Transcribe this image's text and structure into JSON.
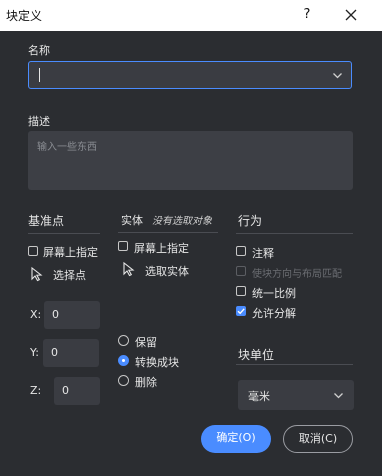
{
  "window": {
    "title": "块定义",
    "help": "?"
  },
  "name": {
    "label": "名称",
    "value": ""
  },
  "description": {
    "label": "描述",
    "placeholder": "输入一些东西"
  },
  "base_point": {
    "heading": "基准点",
    "specify_on_screen": "屏幕上指定",
    "pick_point": "选择点",
    "x": {
      "label": "X:",
      "value": "0"
    },
    "y": {
      "label": "Y:",
      "value": "0"
    },
    "z": {
      "label": "Z:",
      "value": "0"
    }
  },
  "objects": {
    "heading": "实体",
    "status": "没有选取对象",
    "specify_on_screen": "屏幕上指定",
    "select_objects": "选取实体",
    "options": [
      {
        "label": "保留",
        "selected": false
      },
      {
        "label": "转换成块",
        "selected": true
      },
      {
        "label": "删除",
        "selected": false
      }
    ]
  },
  "behavior": {
    "heading": "行为",
    "annotative": {
      "label": "注释",
      "checked": false
    },
    "match_orientation": {
      "label": "使块方向与布局匹配",
      "checked": false,
      "disabled": true
    },
    "scale_uniformly": {
      "label": "统一比例",
      "checked": false
    },
    "allow_explode": {
      "label": "允许分解",
      "checked": true
    }
  },
  "block_unit": {
    "heading": "块单位",
    "value": "毫米"
  },
  "buttons": {
    "ok": "确定(O)",
    "cancel": "取消(C)"
  },
  "colors": {
    "accent": "#4a8cff",
    "background": "#2b2d31"
  }
}
